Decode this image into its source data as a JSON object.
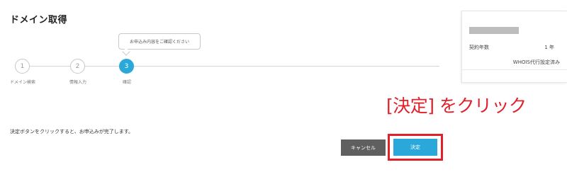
{
  "page": {
    "title": "ドメイン取得"
  },
  "bubble": {
    "text": "お申込み内容をご確認ください"
  },
  "steps": [
    {
      "number": "1",
      "label": "ドメイン検索"
    },
    {
      "number": "2",
      "label": "情報入力"
    },
    {
      "number": "3",
      "label": "確認"
    }
  ],
  "summary": {
    "contract_label": "契約年数",
    "contract_value": "1 年",
    "whois_note": "WHOIS代行設定済み"
  },
  "annotation": {
    "text": "[決定] をクリック"
  },
  "instruction": {
    "text": "決定ボタンをクリックすると、お申込みが完了します。"
  },
  "buttons": {
    "cancel": "キャンセル",
    "decide": "決定"
  },
  "colors": {
    "accent": "#2aa8d9",
    "highlight": "#e0202a",
    "cancel": "#5f5f5f"
  }
}
